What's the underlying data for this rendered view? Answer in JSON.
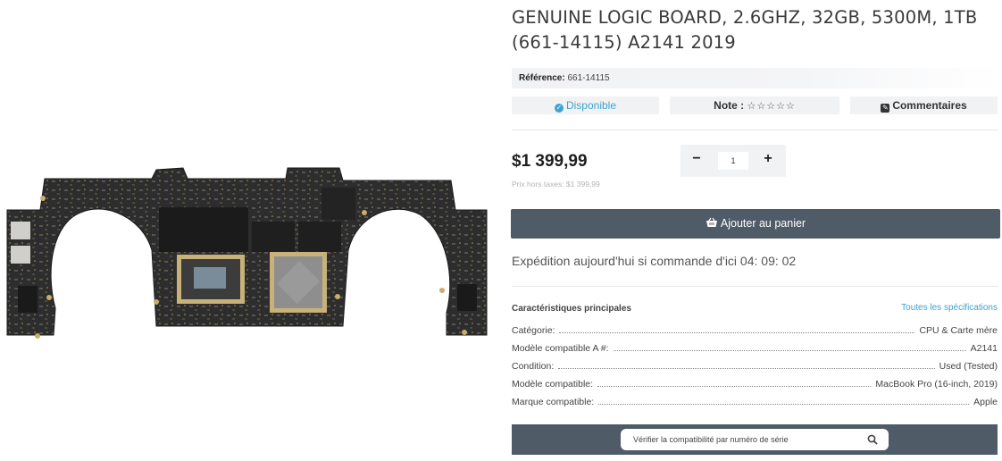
{
  "product": {
    "title": "GENUINE LOGIC BOARD, 2.6GHZ, 32GB, 5300M, 1TB (661-14115) A2141 2019",
    "reference_label": "Référence:",
    "reference_value": "661-14115"
  },
  "badges": {
    "availability": "Disponible",
    "rating_label": "Note :",
    "rating_stars": "☆☆☆☆☆",
    "comments": "Commentaires"
  },
  "price": {
    "amount": "$1 399,99",
    "tax_note": "Prix hors taxes: $1 399,99"
  },
  "quantity": {
    "minus": "−",
    "value": "1",
    "plus": "+"
  },
  "cart_button": "Ajouter au panier",
  "shipping": "Expédition aujourd'hui si commande d'ici 04: 09: 02",
  "specs": {
    "title": "Caractéristiques principales",
    "link": "Toutes les spécifications",
    "rows": [
      {
        "k": "Catégorie:",
        "v": "CPU & Carte mère"
      },
      {
        "k": "Modèle compatible A #:",
        "v": "A2141"
      },
      {
        "k": "Condition:",
        "v": "Used (Tested)"
      },
      {
        "k": "Modèle compatible:",
        "v": "MacBook Pro (16-inch, 2019)"
      },
      {
        "k": "Marque compatible:",
        "v": "Apple"
      }
    ]
  },
  "serial_check": {
    "placeholder": "Vérifier la compatibilité par numéro de série"
  },
  "colors": {
    "accent": "#3ea3cf",
    "button": "#4f5b66",
    "board": "#2b2b2b"
  }
}
